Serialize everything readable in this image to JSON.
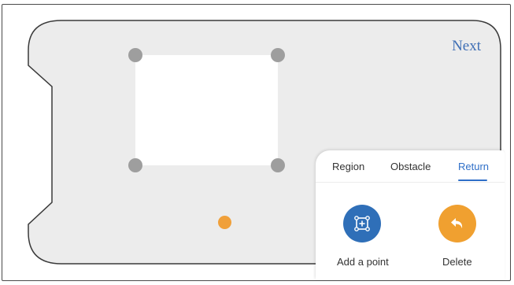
{
  "header": {
    "next_label": "Next"
  },
  "tabs": [
    {
      "label": "Region",
      "active": false
    },
    {
      "label": "Obstacle",
      "active": false
    },
    {
      "label": "Return",
      "active": true
    }
  ],
  "actions": {
    "add_point": {
      "label": "Add a point",
      "icon": "add-point-icon",
      "color": "#2f6fb8"
    },
    "delete": {
      "label": "Delete",
      "icon": "undo-arrow-icon",
      "color": "#f0a030"
    }
  },
  "colors": {
    "map_background": "#ececec",
    "handle": "#9e9e9e",
    "robot_marker": "#f0a03a",
    "accent": "#2f6fc8"
  }
}
